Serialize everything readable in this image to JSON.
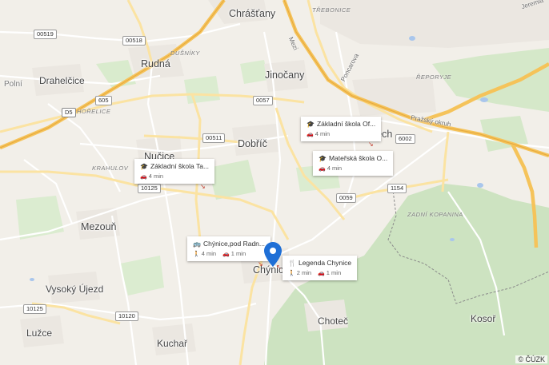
{
  "places": {
    "chrastany": "Chrášťany",
    "rudna": "Rudná",
    "drahelcice": "Drahelčice",
    "polni": "Polní",
    "jinocany": "Jinočany",
    "nucice": "Nučice",
    "dobric": "Dobříč",
    "mezoun": "Mezouň",
    "vysoky_ujezd": "Vysoký Újezd",
    "luzce": "Lužce",
    "kuchar": "Kuchař",
    "chynice": "Chýnice",
    "chotec": "Choteč",
    "kosor": "Kosoř",
    "trebonice": "TŘEBONICE",
    "reporyje": "ŘEPORYJE",
    "zadni_kopanina": "ZADNÍ KOPANINA",
    "dusniky": "DUŠNÍKY",
    "horelice": "HOŘELICE",
    "krahulov": "KRAHULOV",
    "jeremiasova": "Jeremiá",
    "rech": "řech"
  },
  "roads": {
    "r00519": "00519",
    "r00518": "00518",
    "r605": "605",
    "d5": "D5",
    "r0057": "0057",
    "r00511": "00511",
    "r10125a": "10125",
    "r0059": "0059",
    "r1154": "1154",
    "r6002": "6002",
    "r10125b": "10125",
    "r10120": "10120",
    "pristavni": "Mezi",
    "poncarova": "Poncarova",
    "prazsky_okruh": "Pražský okruh"
  },
  "cards": [
    {
      "title": "Základní škola Ta...",
      "icon": "school-icon",
      "walk": "",
      "drive": "4 min"
    },
    {
      "title": "Základní škola Of...",
      "icon": "school-icon",
      "walk": "",
      "drive": "4 min"
    },
    {
      "title": "Mateřská škola O...",
      "icon": "school-icon",
      "walk": "",
      "drive": "4 min"
    },
    {
      "title": "Chýnice,pod Radn...",
      "icon": "bus-icon",
      "walk": "4 min",
      "drive": "1 min"
    },
    {
      "title": "Legenda Chynice",
      "icon": "restaurant-icon",
      "walk": "2 min",
      "drive": "1 min"
    }
  ],
  "attribution": "© ČÚZK",
  "colors": {
    "pin": "#1f6fd6",
    "forest": "#cfe4c3",
    "road_major": "#f6cf6b"
  }
}
